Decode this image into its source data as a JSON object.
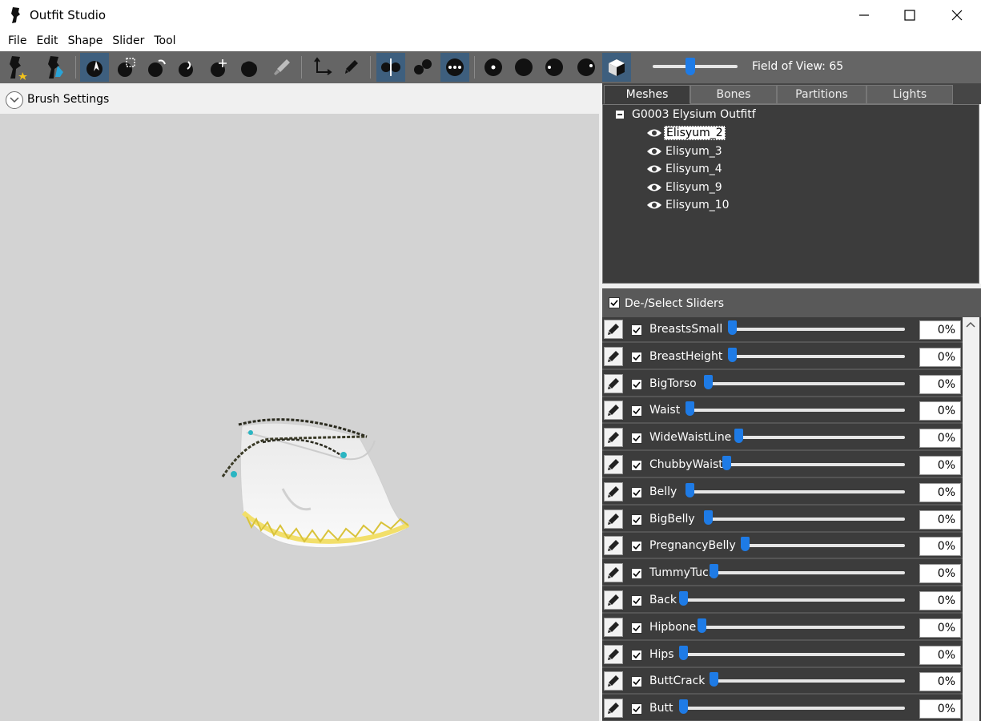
{
  "window": {
    "title": "Outfit Studio"
  },
  "menu": [
    "File",
    "Edit",
    "Shape",
    "Slider",
    "Tool"
  ],
  "toolbar": {
    "fov_label": "Field of View: 65",
    "fov_value": 65
  },
  "left": {
    "brush_settings_label": "Brush Settings"
  },
  "tabs": [
    "Meshes",
    "Bones",
    "Partitions",
    "Lights"
  ],
  "tree": {
    "root": "G0003 Elysium Outfitf",
    "items": [
      "Elisyum_2",
      "Elisyum_3",
      "Elisyum_4",
      "Elisyum_9",
      "Elisyum_10"
    ]
  },
  "sliders": {
    "deselect_label": "De-/Select Sliders",
    "items": [
      {
        "name": "BreastsSmall",
        "value": "0%",
        "pos": 0.16
      },
      {
        "name": "BreastHeight",
        "value": "0%",
        "pos": 0.17
      },
      {
        "name": "BigTorso",
        "value": "0%",
        "pos": 0.02
      },
      {
        "name": "Waist",
        "value": "0%",
        "pos": -0.06
      },
      {
        "name": "WideWaistLine",
        "value": "0%",
        "pos": 0.24
      },
      {
        "name": "ChubbyWaist",
        "value": "0%",
        "pos": 0.19
      },
      {
        "name": "Belly",
        "value": "0%",
        "pos": 0.0
      },
      {
        "name": "BigBelly",
        "value": "0%",
        "pos": 0.08
      },
      {
        "name": "PregnancyBelly",
        "value": "0%",
        "pos": 0.23
      },
      {
        "name": "TummyTuck",
        "value": "0%",
        "pos": 0.19
      },
      {
        "name": "Back",
        "value": "0%",
        "pos": 0.0
      },
      {
        "name": "Hipbone",
        "value": "0%",
        "pos": 0.09
      },
      {
        "name": "Hips",
        "value": "0%",
        "pos": 0.0
      },
      {
        "name": "ButtCrack",
        "value": "0%",
        "pos": 0.14
      },
      {
        "name": "Butt",
        "value": "0%",
        "pos": -0.02
      }
    ]
  }
}
